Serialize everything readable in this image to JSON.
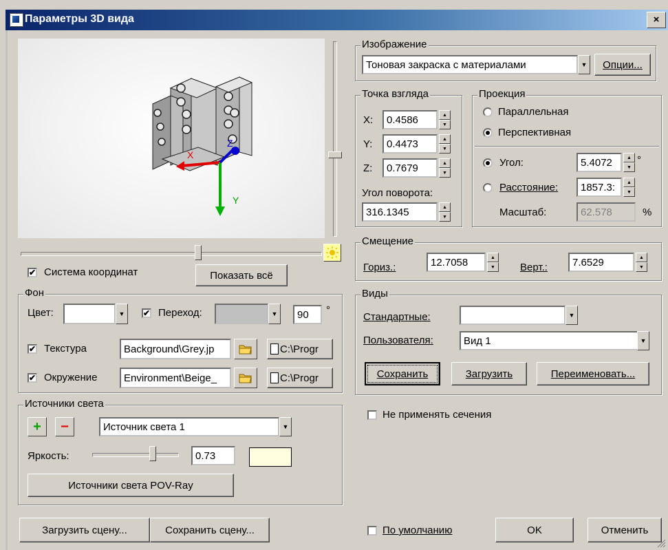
{
  "window": {
    "title": "Параметры 3D вида",
    "close_label": "×"
  },
  "viewport": {
    "axes": {
      "x": "X",
      "y": "Y",
      "z": "Z"
    }
  },
  "coords_checkbox": {
    "label": "Система координат",
    "checked": true
  },
  "show_all_button": "Показать всё",
  "background": {
    "group_label": "Фон",
    "color_label": "Цвет:",
    "color_value": "#ffffff",
    "transition_label": "Переход:",
    "transition_checked": true,
    "transition_color": "#c0c0c0",
    "angle_value": "90",
    "angle_unit": "°",
    "texture_label": "Текстура",
    "texture_checked": true,
    "texture_path": "Background\\Grey.jp",
    "texture_dir": "C:\\Progr",
    "environment_label": "Окружение",
    "environment_checked": true,
    "environment_path": "Environment\\Beige_",
    "environment_dir": "C:\\Progr"
  },
  "lights": {
    "group_label": "Источники света",
    "add_label": "+",
    "remove_label": "−",
    "selected": "Источник света 1",
    "brightness_label": "Яркость:",
    "brightness_value": "0.73",
    "brightness_level": 0.73,
    "light_color": "#ffffe0",
    "povray_button": "Источники света POV-Ray"
  },
  "image": {
    "group_label": "Изображение",
    "mode": "Тоновая закраска с материалами",
    "options_button": "Опции..."
  },
  "viewpoint": {
    "group_label": "Точка взгляда",
    "x_label": "X:",
    "x_value": "0.4586",
    "y_label": "Y:",
    "y_value": "0.4473",
    "z_label": "Z:",
    "z_value": "0.7679",
    "rotation_label": "Угол поворота:",
    "rotation_value": "316.1345"
  },
  "projection": {
    "group_label": "Проекция",
    "parallel_label": "Параллельная",
    "perspective_label": "Перспективная",
    "selected": "perspective",
    "angle_label": "Угол:",
    "angle_value": "5.4072",
    "angle_unit": "°",
    "distance_label": "Расстояние:",
    "distance_value": "1857.3:",
    "scale_label": "Масштаб:",
    "scale_value": "62.578",
    "scale_unit": "%"
  },
  "offset": {
    "group_label": "Смещение",
    "horiz_label": "Гориз.:",
    "horiz_value": "12.7058",
    "vert_label": "Верт.:",
    "vert_value": "7.6529"
  },
  "views": {
    "group_label": "Виды",
    "standard_label": "Стандартные:",
    "standard_value": "",
    "user_label": "Пользователя:",
    "user_value": "Вид 1",
    "save_button": "Сохранить",
    "load_button": "Загрузить",
    "rename_button": "Переименовать..."
  },
  "no_sections": {
    "label": "Не применять сечения",
    "checked": false
  },
  "footer": {
    "load_scene": "Загрузить сцену...",
    "save_scene": "Сохранить сцену...",
    "default_label": "По умолчанию",
    "default_checked": false,
    "ok": "OK",
    "cancel": "Отменить"
  }
}
